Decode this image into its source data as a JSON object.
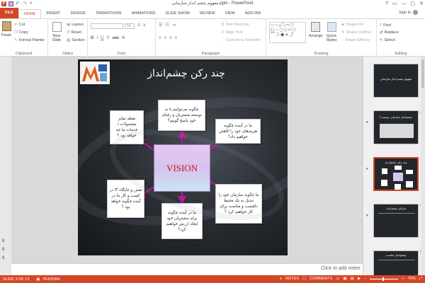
{
  "window": {
    "title": "مفهوم چشم انداز سازمانی.pptx - PowerPoint",
    "controls": [
      "?",
      "▭",
      "—",
      "▢",
      "✕"
    ]
  },
  "ribbon_tabs": [
    "FILE",
    "HOME",
    "INSERT",
    "DESIGN",
    "TRANSITIONS",
    "ANIMATIONS",
    "SLIDE SHOW",
    "REVIEW",
    "VIEW",
    "ADD-INS"
  ],
  "active_tab": "HOME",
  "signin": "Sign in",
  "clipboard": {
    "paste": "Paste",
    "cut": "Cut",
    "copy": "Copy",
    "format_painter": "Format Painter",
    "label": "Clipboard"
  },
  "slides_group": {
    "new_slide": "New Slide",
    "layout": "Layout",
    "reset": "Reset",
    "section": "Section",
    "label": "Slides"
  },
  "font_group": {
    "size_value": "54",
    "label": "Font"
  },
  "paragraph_group": {
    "text_direction": "Text Direction",
    "align_text": "Align Text",
    "smartart": "Convert to SmartArt",
    "label": "Paragraph"
  },
  "drawing_group": {
    "arrange": "Arrange",
    "quick_styles": "Quick Styles",
    "shape_fill": "Shape Fill",
    "shape_outline": "Shape Outline",
    "shape_effects": "Shape Effects",
    "label": "Drawing"
  },
  "editing_group": {
    "find": "Find",
    "replace": "Replace",
    "select": "Select",
    "label": "Editing"
  },
  "left_numbers": [
    "8",
    "8",
    "8"
  ],
  "slide": {
    "title": "چند رکن چشم‌انداز",
    "center": "VISION",
    "boxes": [
      {
        "text": "چگونه می‌توانیم تا به توسعه مشتریان و رقبای خود پاسخ گوییم؟"
      },
      {
        "text": "نقطه تمایز محصولات / خدمات ما چه خواهد بود ؟"
      },
      {
        "text": "ما در آینده چگونه هزینه‌های خود را کاهش خواهیم داد؟"
      },
      {
        "text": "ما چگونه سازمان خود را تبدیل به یک محیط دلچسب و مناسب برای کار خواهیم کرد ؟"
      },
      {
        "text": "ما در آینده چگونه برای مشتریان خود ایجاد ارزش خواهیم کرد؟"
      },
      {
        "text": "نقش و جایگاه IT در کسب و کار ما در آینده چگونه خواهد بود ؟"
      }
    ]
  },
  "notes_placeholder": "Click to add notes",
  "thumbnails": [
    {
      "num": "1",
      "title": "مفهوم چشم انداز سازمانی"
    },
    {
      "num": "2",
      "title": "چشم‌انداز سازمانی چیست؟"
    },
    {
      "num": "3",
      "title": "چند رکن چشم‌انداز"
    },
    {
      "num": "4",
      "title": "مزایای چشم‌انداز"
    },
    {
      "num": "5",
      "title": "چشم‌انداز مناسب"
    }
  ],
  "status": {
    "slide_of": "SLIDE 3 OF 13",
    "language": "PERSIAN",
    "notes": "NOTES",
    "comments": "COMMENTS",
    "zoom": "70%"
  },
  "colors": {
    "accent": "#d24726",
    "center_text": "#d0101a",
    "arrow": "#c0149c"
  }
}
